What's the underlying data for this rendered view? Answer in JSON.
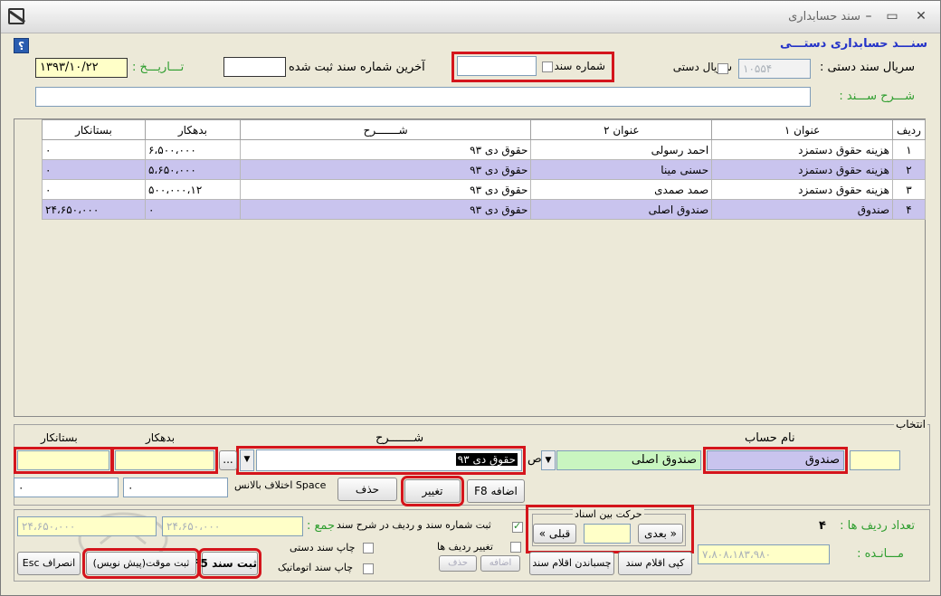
{
  "window": {
    "title": "سند حسابداری"
  },
  "form": {
    "title": "سنـــد حسابداری دستـــی",
    "manual_serial_label": "سریال سند دستی :",
    "manual_serial_value": "١٠۵۵۴",
    "manual_serial_cb": "سریال دستی",
    "doc_number_cb": "شماره سند",
    "last_doc_label": "آخرین شماره سند ثبت شده",
    "date_label": "تـــاریـــخ :",
    "date_value": "١٣٩٣/١٠/٢٢",
    "desc_label": "شـــرح ســـند :"
  },
  "table": {
    "headers": [
      "ردیف",
      "عنوان ١",
      "عنوان ٢",
      "شـــــــرح",
      "بدهکار",
      "بستانکار"
    ],
    "rows": [
      {
        "idx": "١",
        "t1": "هزینه حقوق دستمزد",
        "t2": "احمد رسولی",
        "desc": "حقوق دی ٩٣",
        "debit": "۶،۵٠٠،٠٠٠",
        "credit": "٠"
      },
      {
        "idx": "٢",
        "t1": "هزینه حقوق دستمزد",
        "t2": "حسنی مینا",
        "desc": "حقوق دی ٩٣",
        "debit": "۵،۶۵٠،٠٠٠",
        "credit": "٠"
      },
      {
        "idx": "٣",
        "t1": "هزینه حقوق دستمزد",
        "t2": "صمد صمدی",
        "desc": "حقوق دی ٩٣",
        "debit": "١٢،۵٠٠،٠٠٠",
        "credit": "٠"
      },
      {
        "idx": "۴",
        "t1": "صندوق",
        "t2": "صندوق اصلی",
        "desc": "حقوق دی ٩٣",
        "debit": "٠",
        "credit": "٢۴،۶۵٠،٠٠٠"
      }
    ]
  },
  "select": {
    "legend": "انتخاب",
    "account_label": "نام حساب",
    "desc_label": "شـــــــرح",
    "debit_label": "بدهکار",
    "credit_label": "بستانکار",
    "account_value": "صندوق",
    "sub_account_value": "صندوق اصلی",
    "desc_value": "حقوق دی ٩٣",
    "desc_partial": "ص",
    "ellipsis": "...",
    "small1": "٠",
    "small2": "٠",
    "balance_label": "Space اختلاف بالانس",
    "btn_delete": "حذف",
    "btn_change": "تغییر",
    "btn_add": "اضافه F8"
  },
  "footer": {
    "sum_label": "جمع :",
    "sum_value1": "٢۴،۶۵٠،٠٠٠",
    "sum_value2": "٢۴،۶۵٠،٠٠٠",
    "cb_register": "ثبت شماره سند و ردیف در شرح سند",
    "cb_print_manual": "چاپ سند دستی",
    "cb_print_auto": "چاپ سند اتوماتیک",
    "cb_change_rows": "تغییر ردیف ها",
    "btn_add_small": "اضافه",
    "btn_del_small": "حذف",
    "nav_legend": "حرکت بین اسناد",
    "nav_next": "« بعدی",
    "nav_prev": "قبلی »",
    "row_count_label": "تعداد ردیف ها :",
    "row_count": "۴",
    "remain_label": "مـــانـده :",
    "remain_value": "٧،٨٠٨،١٨٣،٩٨٠",
    "btn_copy": "کپی اقلام سند",
    "btn_paste": "چسباندن اقلام سند",
    "btn_save": "ثبت سند F5",
    "btn_temp": "ثبت موقت(پیش نویس)",
    "btn_cancel": "انصراف Esc"
  }
}
